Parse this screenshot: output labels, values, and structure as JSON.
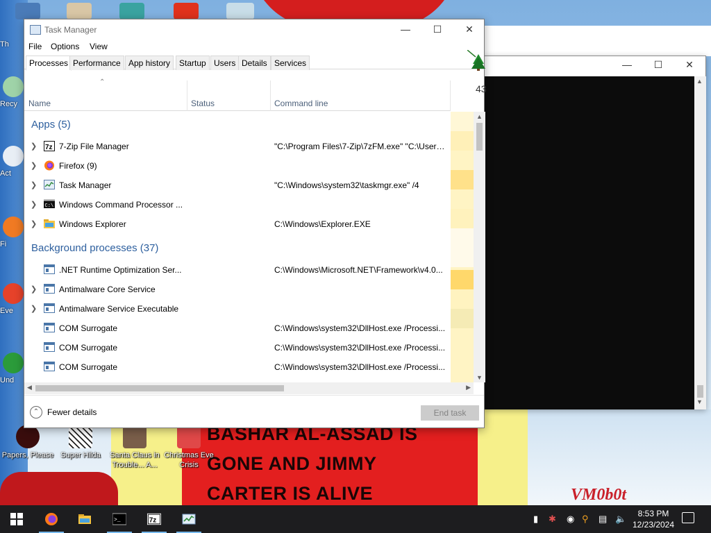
{
  "desktop": {
    "icons_left": [
      {
        "label": "Th"
      },
      {
        "label": "Recy"
      },
      {
        "label": "Act"
      },
      {
        "label": "Fi"
      },
      {
        "label": "Eve"
      },
      {
        "label": "Und"
      }
    ],
    "icons_bottom": [
      {
        "label": "Papers, Please"
      },
      {
        "label": "Super Hilda"
      },
      {
        "label": "Santa Claus in Trouble... A..."
      },
      {
        "label": "Christmas Eve Crisis"
      }
    ],
    "wallpaper_text": [
      "BASHAR AL-ASSAD IS",
      "GONE AND JIMMY",
      "CARTER IS ALIVE"
    ],
    "wallpaper_signature": "VM0b0t"
  },
  "task_manager": {
    "title": "Task Manager",
    "menu": [
      "File",
      "Options",
      "View"
    ],
    "tabs": [
      "Processes",
      "Performance",
      "App history",
      "Startup",
      "Users",
      "Details",
      "Services"
    ],
    "active_tab": "Processes",
    "columns": {
      "name": "Name",
      "status": "Status",
      "command_line": "Command line",
      "cpu_percent": "43"
    },
    "groups": {
      "apps": "Apps (5)",
      "background": "Background processes (37)"
    },
    "apps": [
      {
        "name": "7-Zip File Manager",
        "cmd": "\"C:\\Program Files\\7-Zip\\7zFM.exe\" \"C:\\Users...",
        "icon": "7zip-icon"
      },
      {
        "name": "Firefox (9)",
        "cmd": "",
        "icon": "firefox-icon"
      },
      {
        "name": "Task Manager",
        "cmd": "\"C:\\Windows\\system32\\taskmgr.exe\" /4",
        "icon": "task-manager-icon"
      },
      {
        "name": "Windows Command Processor ...",
        "cmd": "",
        "icon": "cmd-icon"
      },
      {
        "name": "Windows Explorer",
        "cmd": "C:\\Windows\\Explorer.EXE",
        "icon": "explorer-icon"
      }
    ],
    "background": [
      {
        "name": ".NET Runtime Optimization Ser...",
        "cmd": "C:\\Windows\\Microsoft.NET\\Framework\\v4.0...",
        "expandable": false
      },
      {
        "name": "Antimalware Core Service",
        "cmd": "",
        "expandable": true
      },
      {
        "name": "Antimalware Service Executable",
        "cmd": "",
        "expandable": true
      },
      {
        "name": "COM Surrogate",
        "cmd": "C:\\Windows\\system32\\DllHost.exe /Processi...",
        "expandable": false
      },
      {
        "name": "COM Surrogate",
        "cmd": "C:\\Windows\\system32\\DllHost.exe /Processi...",
        "expandable": false
      },
      {
        "name": "COM Surrogate",
        "cmd": "C:\\Windows\\system32\\DllHost.exe /Processi...",
        "expandable": false
      }
    ],
    "fewer_details": "Fewer details",
    "end_task": "End task"
  },
  "taskbar": {
    "apps": [
      "start-icon",
      "firefox-icon",
      "file-explorer-icon",
      "cmd-icon",
      "7zip-icon",
      "task-manager-icon"
    ],
    "clock_time": "8:53 PM",
    "clock_date": "12/23/2024"
  },
  "colors": {
    "group_header": "#2d5f9e",
    "heat_light": "#fff4c4",
    "heat_mid": "#ffe9a0",
    "heat_strong": "#ffd86b",
    "taskbar": "#1d1d1f"
  }
}
